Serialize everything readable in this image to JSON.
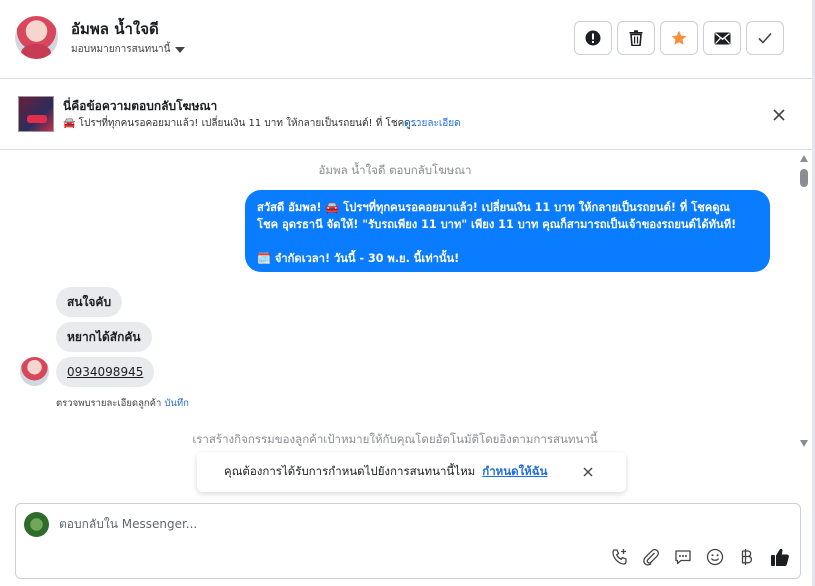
{
  "header": {
    "contact_name": "อัมพล น้ำใจดี",
    "assign_label": "มอบหมายการสนทนานี้",
    "actions": [
      {
        "name": "mark-spam-button",
        "icon": "exclamation-circle-icon"
      },
      {
        "name": "delete-button",
        "icon": "trash-icon"
      },
      {
        "name": "star-button",
        "icon": "star-icon"
      },
      {
        "name": "mark-unread-button",
        "icon": "envelope-icon"
      },
      {
        "name": "mark-done-button",
        "icon": "checkmark-icon"
      }
    ],
    "star_color": "#f7923a"
  },
  "ad_banner": {
    "title": "นี่คือข้อความตอบกลับโฆษณา",
    "snippet": "🚘 โปรฯที่ทุกคนรอคอยมาแล้ว! เปลี่ยนเงิน 11 บาท ให้กลายเป็นรถยนต์! ที่ โชคดู...",
    "details_link": "ดูรายละเอียด"
  },
  "thread": {
    "ad_reply_note": "อัมพล น้ำใจดี ตอบกลับโฆษณา",
    "outgoing_message": {
      "line1": "สวัสดี อัมพล! 🚘 โปรฯที่ทุกคนรอคอยมาแล้ว! เปลี่ยนเงิน 11 บาท ให้กลายเป็นรถยนต์! ที่ โชคดูณ",
      "line2": "โชค อุดรธานี จัดให้! \"รับรถเพียง 11 บาท\" เพียง 11 บาท คุณก็สามารถเป็นเจ้าของรถยนต์ได้ทันที!",
      "line3": "",
      "line4": "🗓️ จำกัดเวลา! วันนี้ - 30 พ.ย. นี้เท่านั้น!"
    },
    "incoming_messages": [
      "สนใจคับ",
      "หยากได้สักคัน",
      "0934098945"
    ],
    "detail_note": "ตรวจพบรายละเอียดลูกค้า",
    "detail_link": "บันทึก",
    "auto_assign_note": "เราสร้างกิจกรรมของลูกค้าเป้าหมายให้กับคุณโดยอัตโนมัติโดยอิงตามการสนทนานี้",
    "bubble_color": "#0a7cff"
  },
  "toast": {
    "question": "คุณต้องการได้รับการกำหนดไปยังการสนทนานี้ไหม",
    "assign_link": "กำหนดให้ฉัน"
  },
  "composer": {
    "placeholder": "ตอบกลับใน Messenger...",
    "tools": [
      "add-call-icon",
      "attachment-icon",
      "saved-reply-icon",
      "emoji-icon",
      "currency-baht-icon",
      "like-icon"
    ]
  }
}
